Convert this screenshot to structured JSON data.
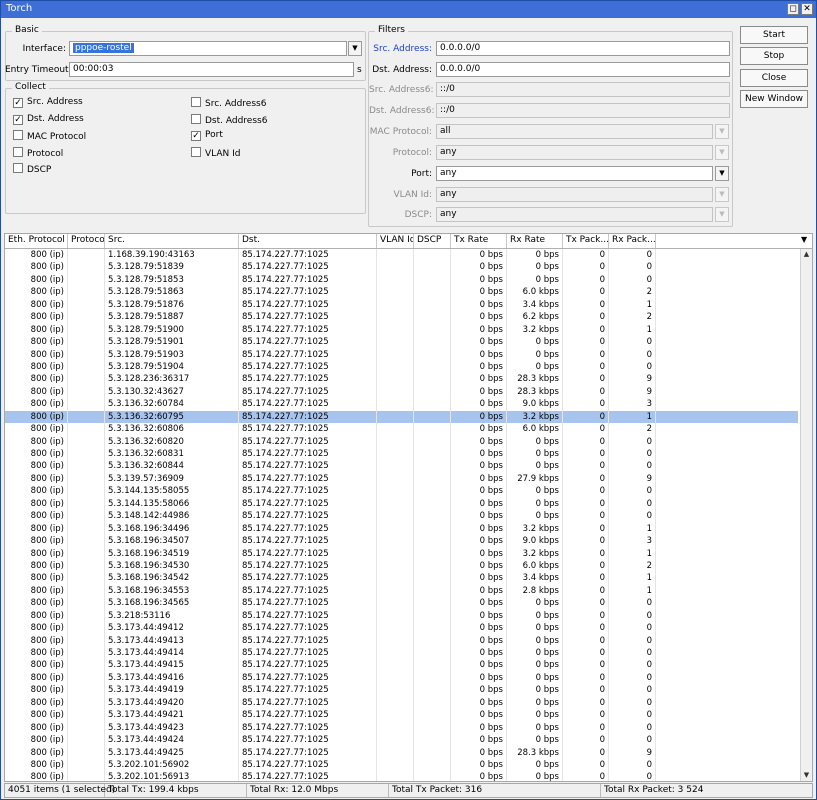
{
  "window": {
    "title": "Torch",
    "restore_btn": "◻",
    "close_btn": "✕"
  },
  "basic": {
    "title": "Basic",
    "interface_label": "Interface:",
    "interface_value": "pppoe-rostel",
    "entry_timeout_label": "Entry Timeout:",
    "entry_timeout_value": "00:00:03",
    "entry_timeout_unit": "s"
  },
  "collect": {
    "title": "Collect",
    "items": [
      {
        "label": "Src. Address",
        "checked": true
      },
      {
        "label": "Dst. Address",
        "checked": true
      },
      {
        "label": "MAC Protocol",
        "checked": false
      },
      {
        "label": "Protocol",
        "checked": false
      },
      {
        "label": "DSCP",
        "checked": false
      },
      {
        "label": "Src. Address6",
        "checked": false
      },
      {
        "label": "Dst. Address6",
        "checked": false
      },
      {
        "label": "Port",
        "checked": true
      },
      {
        "label": "VLAN Id",
        "checked": false
      }
    ]
  },
  "filters": {
    "title": "Filters",
    "src_address_label": "Src. Address:",
    "src_address_value": "0.0.0.0/0",
    "dst_address_label": "Dst. Address:",
    "dst_address_value": "0.0.0.0/0",
    "src_address6_label": "Src. Address6:",
    "src_address6_value": "::/0",
    "dst_address6_label": "Dst. Address6:",
    "dst_address6_value": "::/0",
    "mac_protocol_label": "MAC Protocol:",
    "mac_protocol_value": "all",
    "protocol_label": "Protocol:",
    "protocol_value": "any",
    "port_label": "Port:",
    "port_value": "any",
    "vlan_id_label": "VLAN Id:",
    "vlan_id_value": "any",
    "dscp_label": "DSCP:",
    "dscp_value": "any"
  },
  "buttons": {
    "start": "Start",
    "stop": "Stop",
    "close": "Close",
    "new_window": "New Window"
  },
  "table": {
    "columns": [
      "Eth. Protocol",
      "Protocol",
      "Src.",
      "Dst.",
      "VLAN Id",
      "DSCP",
      "Tx Rate",
      "Rx Rate",
      "Tx Pack...",
      "Rx Pack..."
    ],
    "selected_index": 13,
    "rows": [
      [
        "800 (ip)",
        "",
        "1.168.39.190:43163",
        "85.174.227.77:1025",
        "",
        "",
        "0 bps",
        "0 bps",
        "0",
        "0"
      ],
      [
        "800 (ip)",
        "",
        "5.3.128.79:51839",
        "85.174.227.77:1025",
        "",
        "",
        "0 bps",
        "0 bps",
        "0",
        "0"
      ],
      [
        "800 (ip)",
        "",
        "5.3.128.79:51853",
        "85.174.227.77:1025",
        "",
        "",
        "0 bps",
        "0 bps",
        "0",
        "0"
      ],
      [
        "800 (ip)",
        "",
        "5.3.128.79:51863",
        "85.174.227.77:1025",
        "",
        "",
        "0 bps",
        "6.0 kbps",
        "0",
        "2"
      ],
      [
        "800 (ip)",
        "",
        "5.3.128.79:51876",
        "85.174.227.77:1025",
        "",
        "",
        "0 bps",
        "3.4 kbps",
        "0",
        "1"
      ],
      [
        "800 (ip)",
        "",
        "5.3.128.79:51887",
        "85.174.227.77:1025",
        "",
        "",
        "0 bps",
        "6.2 kbps",
        "0",
        "2"
      ],
      [
        "800 (ip)",
        "",
        "5.3.128.79:51900",
        "85.174.227.77:1025",
        "",
        "",
        "0 bps",
        "3.2 kbps",
        "0",
        "1"
      ],
      [
        "800 (ip)",
        "",
        "5.3.128.79:51901",
        "85.174.227.77:1025",
        "",
        "",
        "0 bps",
        "0 bps",
        "0",
        "0"
      ],
      [
        "800 (ip)",
        "",
        "5.3.128.79:51903",
        "85.174.227.77:1025",
        "",
        "",
        "0 bps",
        "0 bps",
        "0",
        "0"
      ],
      [
        "800 (ip)",
        "",
        "5.3.128.79:51904",
        "85.174.227.77:1025",
        "",
        "",
        "0 bps",
        "0 bps",
        "0",
        "0"
      ],
      [
        "800 (ip)",
        "",
        "5.3.128.236:36317",
        "85.174.227.77:1025",
        "",
        "",
        "0 bps",
        "28.3 kbps",
        "0",
        "9"
      ],
      [
        "800 (ip)",
        "",
        "5.3.130.32:43627",
        "85.174.227.77:1025",
        "",
        "",
        "0 bps",
        "28.3 kbps",
        "0",
        "9"
      ],
      [
        "800 (ip)",
        "",
        "5.3.136.32:60784",
        "85.174.227.77:1025",
        "",
        "",
        "0 bps",
        "9.0 kbps",
        "0",
        "3"
      ],
      [
        "800 (ip)",
        "",
        "5.3.136.32:60795",
        "85.174.227.77:1025",
        "",
        "",
        "0 bps",
        "3.2 kbps",
        "0",
        "1"
      ],
      [
        "800 (ip)",
        "",
        "5.3.136.32:60806",
        "85.174.227.77:1025",
        "",
        "",
        "0 bps",
        "6.0 kbps",
        "0",
        "2"
      ],
      [
        "800 (ip)",
        "",
        "5.3.136.32:60820",
        "85.174.227.77:1025",
        "",
        "",
        "0 bps",
        "0 bps",
        "0",
        "0"
      ],
      [
        "800 (ip)",
        "",
        "5.3.136.32:60831",
        "85.174.227.77:1025",
        "",
        "",
        "0 bps",
        "0 bps",
        "0",
        "0"
      ],
      [
        "800 (ip)",
        "",
        "5.3.136.32:60844",
        "85.174.227.77:1025",
        "",
        "",
        "0 bps",
        "0 bps",
        "0",
        "0"
      ],
      [
        "800 (ip)",
        "",
        "5.3.139.57:36909",
        "85.174.227.77:1025",
        "",
        "",
        "0 bps",
        "27.9 kbps",
        "0",
        "9"
      ],
      [
        "800 (ip)",
        "",
        "5.3.144.135:58055",
        "85.174.227.77:1025",
        "",
        "",
        "0 bps",
        "0 bps",
        "0",
        "0"
      ],
      [
        "800 (ip)",
        "",
        "5.3.144.135:58066",
        "85.174.227.77:1025",
        "",
        "",
        "0 bps",
        "0 bps",
        "0",
        "0"
      ],
      [
        "800 (ip)",
        "",
        "5.3.148.142:44986",
        "85.174.227.77:1025",
        "",
        "",
        "0 bps",
        "0 bps",
        "0",
        "0"
      ],
      [
        "800 (ip)",
        "",
        "5.3.168.196:34496",
        "85.174.227.77:1025",
        "",
        "",
        "0 bps",
        "3.2 kbps",
        "0",
        "1"
      ],
      [
        "800 (ip)",
        "",
        "5.3.168.196:34507",
        "85.174.227.77:1025",
        "",
        "",
        "0 bps",
        "9.0 kbps",
        "0",
        "3"
      ],
      [
        "800 (ip)",
        "",
        "5.3.168.196:34519",
        "85.174.227.77:1025",
        "",
        "",
        "0 bps",
        "3.2 kbps",
        "0",
        "1"
      ],
      [
        "800 (ip)",
        "",
        "5.3.168.196:34530",
        "85.174.227.77:1025",
        "",
        "",
        "0 bps",
        "6.0 kbps",
        "0",
        "2"
      ],
      [
        "800 (ip)",
        "",
        "5.3.168.196:34542",
        "85.174.227.77:1025",
        "",
        "",
        "0 bps",
        "3.4 kbps",
        "0",
        "1"
      ],
      [
        "800 (ip)",
        "",
        "5.3.168.196:34553",
        "85.174.227.77:1025",
        "",
        "",
        "0 bps",
        "2.8 kbps",
        "0",
        "1"
      ],
      [
        "800 (ip)",
        "",
        "5.3.168.196:34565",
        "85.174.227.77:1025",
        "",
        "",
        "0 bps",
        "0 bps",
        "0",
        "0"
      ],
      [
        "800 (ip)",
        "",
        "5.3.218:53116",
        "85.174.227.77:1025",
        "",
        "",
        "0 bps",
        "0 bps",
        "0",
        "0"
      ],
      [
        "800 (ip)",
        "",
        "5.3.173.44:49412",
        "85.174.227.77:1025",
        "",
        "",
        "0 bps",
        "0 bps",
        "0",
        "0"
      ],
      [
        "800 (ip)",
        "",
        "5.3.173.44:49413",
        "85.174.227.77:1025",
        "",
        "",
        "0 bps",
        "0 bps",
        "0",
        "0"
      ],
      [
        "800 (ip)",
        "",
        "5.3.173.44:49414",
        "85.174.227.77:1025",
        "",
        "",
        "0 bps",
        "0 bps",
        "0",
        "0"
      ],
      [
        "800 (ip)",
        "",
        "5.3.173.44:49415",
        "85.174.227.77:1025",
        "",
        "",
        "0 bps",
        "0 bps",
        "0",
        "0"
      ],
      [
        "800 (ip)",
        "",
        "5.3.173.44:49416",
        "85.174.227.77:1025",
        "",
        "",
        "0 bps",
        "0 bps",
        "0",
        "0"
      ],
      [
        "800 (ip)",
        "",
        "5.3.173.44:49419",
        "85.174.227.77:1025",
        "",
        "",
        "0 bps",
        "0 bps",
        "0",
        "0"
      ],
      [
        "800 (ip)",
        "",
        "5.3.173.44:49420",
        "85.174.227.77:1025",
        "",
        "",
        "0 bps",
        "0 bps",
        "0",
        "0"
      ],
      [
        "800 (ip)",
        "",
        "5.3.173.44:49421",
        "85.174.227.77:1025",
        "",
        "",
        "0 bps",
        "0 bps",
        "0",
        "0"
      ],
      [
        "800 (ip)",
        "",
        "5.3.173.44:49423",
        "85.174.227.77:1025",
        "",
        "",
        "0 bps",
        "0 bps",
        "0",
        "0"
      ],
      [
        "800 (ip)",
        "",
        "5.3.173.44:49424",
        "85.174.227.77:1025",
        "",
        "",
        "0 bps",
        "0 bps",
        "0",
        "0"
      ],
      [
        "800 (ip)",
        "",
        "5.3.173.44:49425",
        "85.174.227.77:1025",
        "",
        "",
        "0 bps",
        "28.3 kbps",
        "0",
        "9"
      ],
      [
        "800 (ip)",
        "",
        "5.3.202.101:56902",
        "85.174.227.77:1025",
        "",
        "",
        "0 bps",
        "0 bps",
        "0",
        "0"
      ],
      [
        "800 (ip)",
        "",
        "5.3.202.101:56913",
        "85.174.227.77:1025",
        "",
        "",
        "0 bps",
        "0 bps",
        "0",
        "0"
      ]
    ]
  },
  "status": {
    "items": "4051 items (1 selected)",
    "total_tx": "Total Tx: 199.4 kbps",
    "total_rx": "Total Rx: 12.0 Mbps",
    "total_tx_packet": "Total Tx Packet: 316",
    "total_rx_packet": "Total Rx Packet: 3 524"
  }
}
